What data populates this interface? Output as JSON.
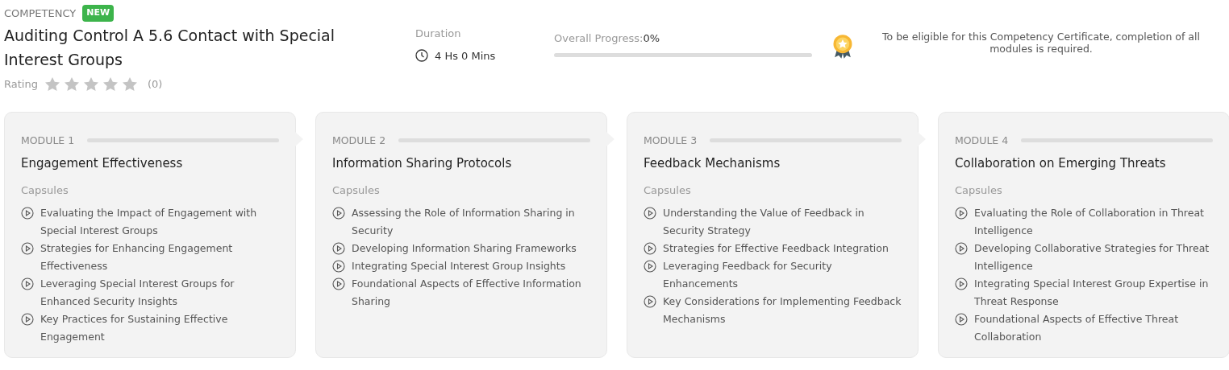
{
  "header": {
    "category": "COMPETENCY",
    "badge": "NEW",
    "title": "Auditing Control A 5.6 Contact with Special Interest Groups",
    "rating": {
      "label": "Rating",
      "stars": 0,
      "count": "(0)"
    },
    "duration": {
      "label": "Duration",
      "value": "4 Hs 0 Mins"
    },
    "progress": {
      "label": "Overall Progress:",
      "value": "0%",
      "level": 0
    },
    "certificate": {
      "text": "To be eligible for this Competency Certificate, completion of all modules is required."
    }
  },
  "modules": [
    {
      "label": "MODULE 1",
      "level": 0,
      "title": "Engagement Effectiveness",
      "capsules_label": "Capsules",
      "capsules": [
        "Evaluating the Impact of Engagement with Special Interest Groups",
        "Strategies for Enhancing Engagement Effectiveness",
        "Leveraging Special Interest Groups for Enhanced Security Insights",
        "Key Practices for Sustaining Effective Engagement"
      ]
    },
    {
      "label": "MODULE 2",
      "level": 0,
      "title": "Information Sharing Protocols",
      "capsules_label": "Capsules",
      "capsules": [
        "Assessing the Role of Information Sharing in Security",
        "Developing Information Sharing Frameworks",
        "Integrating Special Interest Group Insights",
        "Foundational Aspects of Effective Information Sharing"
      ]
    },
    {
      "label": "MODULE 3",
      "level": 0,
      "title": "Feedback Mechanisms",
      "capsules_label": "Capsules",
      "capsules": [
        "Understanding the Value of Feedback in Security Strategy",
        "Strategies for Effective Feedback Integration",
        "Leveraging Feedback for Security Enhancements",
        "Key Considerations for Implementing Feedback Mechanisms"
      ]
    },
    {
      "label": "MODULE 4",
      "level": 0,
      "title": "Collaboration on Emerging Threats",
      "capsules_label": "Capsules",
      "capsules": [
        "Evaluating the Role of Collaboration in Threat Intelligence",
        "Developing Collaborative Strategies for Threat Intelligence",
        "Integrating Special Interest Group Expertise in Threat Response",
        "Foundational Aspects of Effective Threat Collaboration"
      ]
    }
  ]
}
